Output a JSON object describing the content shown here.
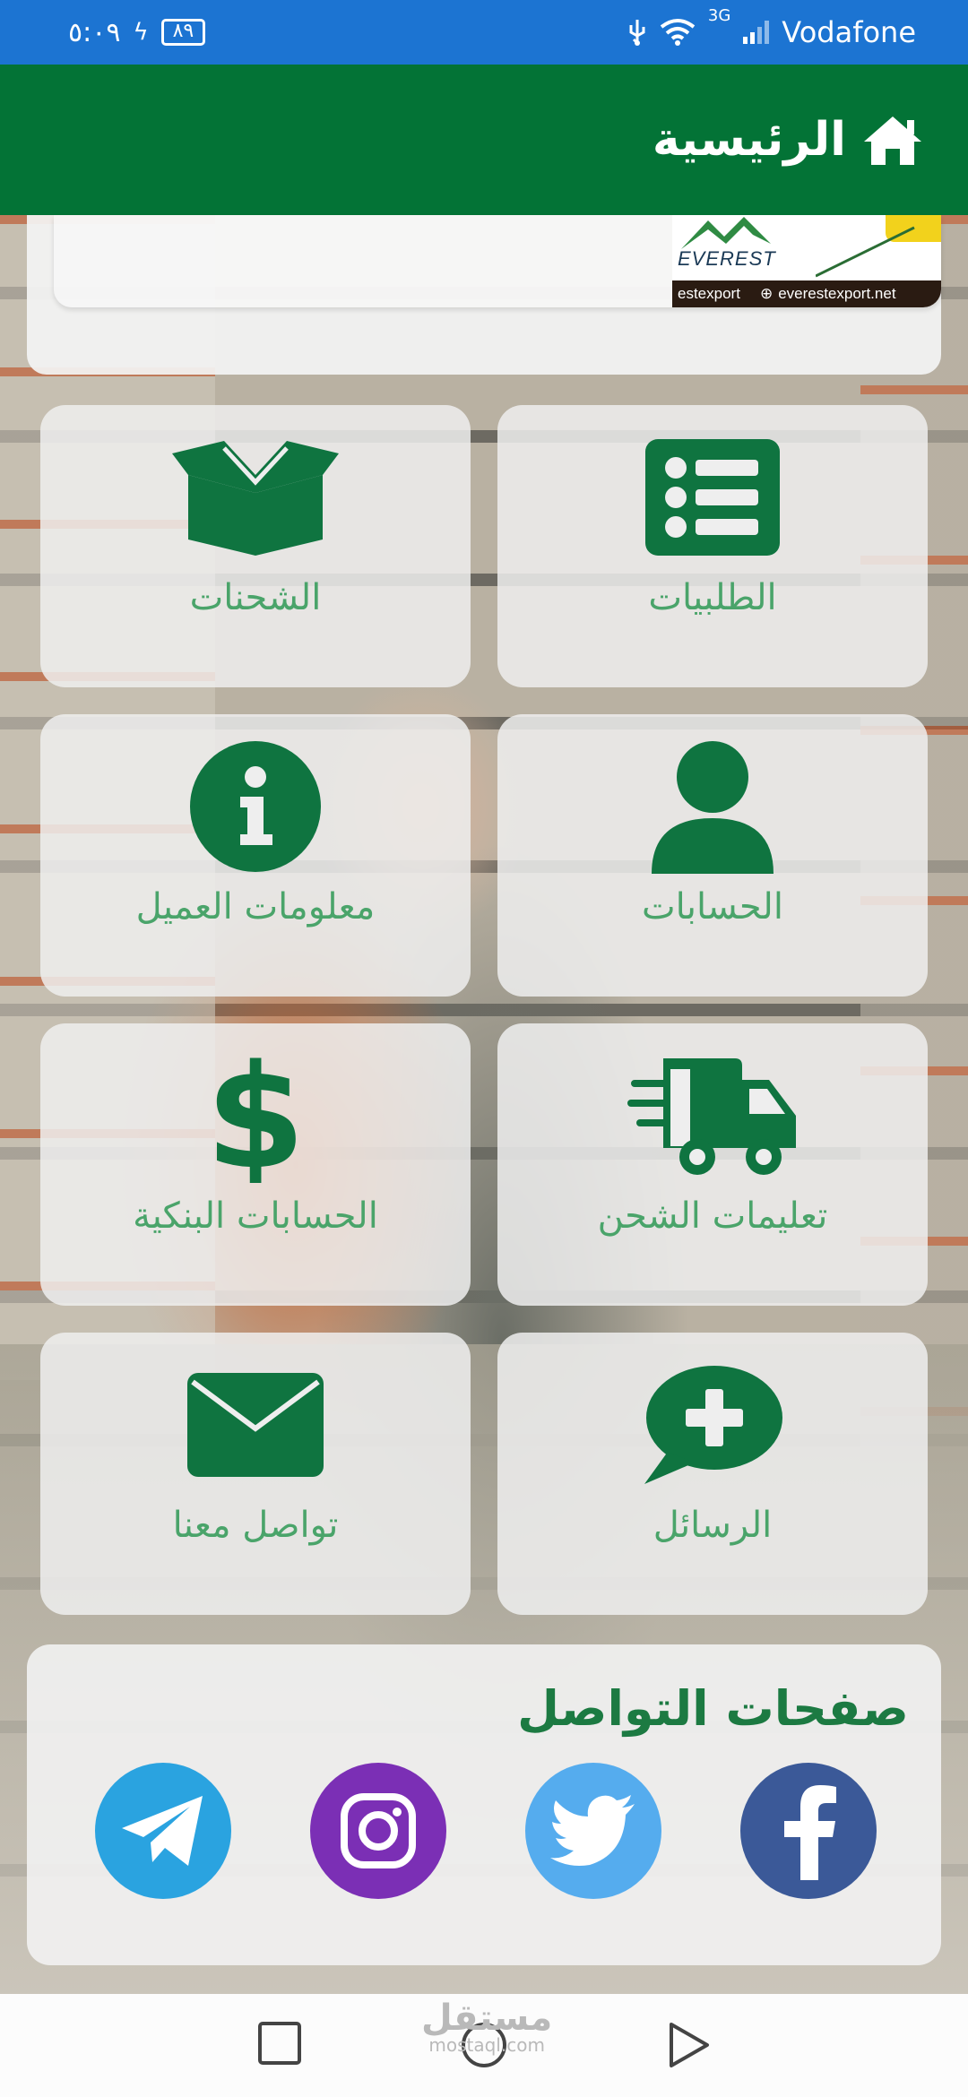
{
  "status_bar": {
    "time": "٥:٠٩",
    "battery": "٨٩",
    "network_type": "3G",
    "carrier": "Vodafone"
  },
  "app_bar": {
    "title": "الرئيسية",
    "icon": "home-icon"
  },
  "banner": {
    "logo_text": "EVEREST",
    "handle": "estexport",
    "website": "everestexport.net"
  },
  "tiles": [
    {
      "label": "الطلبيات",
      "icon": "list-icon"
    },
    {
      "label": "الشحنات",
      "icon": "open-box-icon"
    },
    {
      "label": "الحسابات",
      "icon": "user-icon"
    },
    {
      "label": "معلومات العميل",
      "icon": "info-icon"
    },
    {
      "label": "تعليمات الشحن",
      "icon": "shipping-truck-icon"
    },
    {
      "label": "الحسابات البنكية",
      "icon": "dollar-icon"
    },
    {
      "label": "الرسائل",
      "icon": "chat-plus-icon"
    },
    {
      "label": "تواصل معنا",
      "icon": "envelope-icon"
    }
  ],
  "social": {
    "title": "صفحات التواصل",
    "links": [
      {
        "name": "facebook",
        "icon": "facebook-icon",
        "color": "#3b5998"
      },
      {
        "name": "twitter",
        "icon": "twitter-icon",
        "color": "#55acee"
      },
      {
        "name": "instagram",
        "icon": "instagram-icon",
        "color": "#7b2fb5"
      },
      {
        "name": "telegram",
        "icon": "telegram-icon",
        "color": "#2aa3e0"
      }
    ]
  },
  "watermark": {
    "arabic": "مستقل",
    "latin": "mostaql.com"
  },
  "colors": {
    "status_bar": "#1c74d2",
    "app_bar": "#037336",
    "icon_green": "#0f7440",
    "label_green": "#4aa46a"
  }
}
